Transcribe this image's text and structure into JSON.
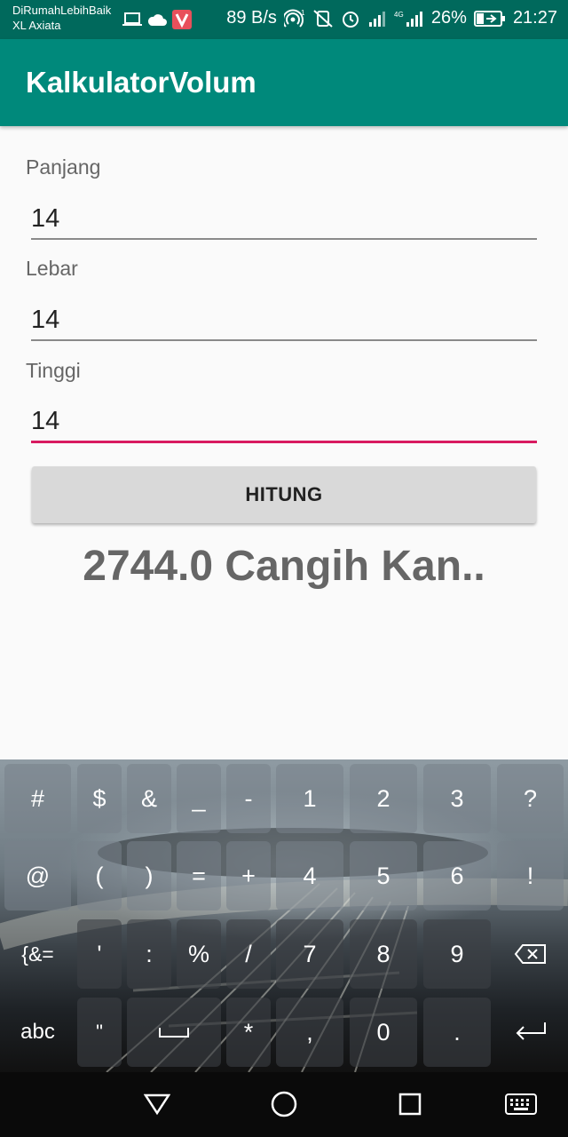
{
  "status_bar": {
    "carrier_line1": "DiRumahLebihBaik",
    "carrier_line2": "XL Axiata",
    "net_speed": "89 B/s",
    "battery": "26%",
    "time": "21:27"
  },
  "app": {
    "title": "KalkulatorVolum"
  },
  "form": {
    "panjang_label": "Panjang",
    "panjang_value": "14",
    "lebar_label": "Lebar",
    "lebar_value": "14",
    "tinggi_label": "Tinggi",
    "tinggi_value": "14",
    "button_label": "HITUNG",
    "result_text": "2744.0 Cangih Kan.."
  },
  "keyboard": {
    "row1": [
      "#",
      "$",
      "&",
      "_",
      "-",
      "1",
      "2",
      "3",
      "?"
    ],
    "row2": [
      "@",
      "(",
      ")",
      "=",
      "+",
      "4",
      "5",
      "6",
      "!"
    ],
    "row3": [
      "{&=",
      "'",
      ":",
      "%",
      "/",
      "7",
      "8",
      "9"
    ],
    "row4": [
      "abc",
      "\"",
      ",",
      "0",
      "."
    ]
  }
}
